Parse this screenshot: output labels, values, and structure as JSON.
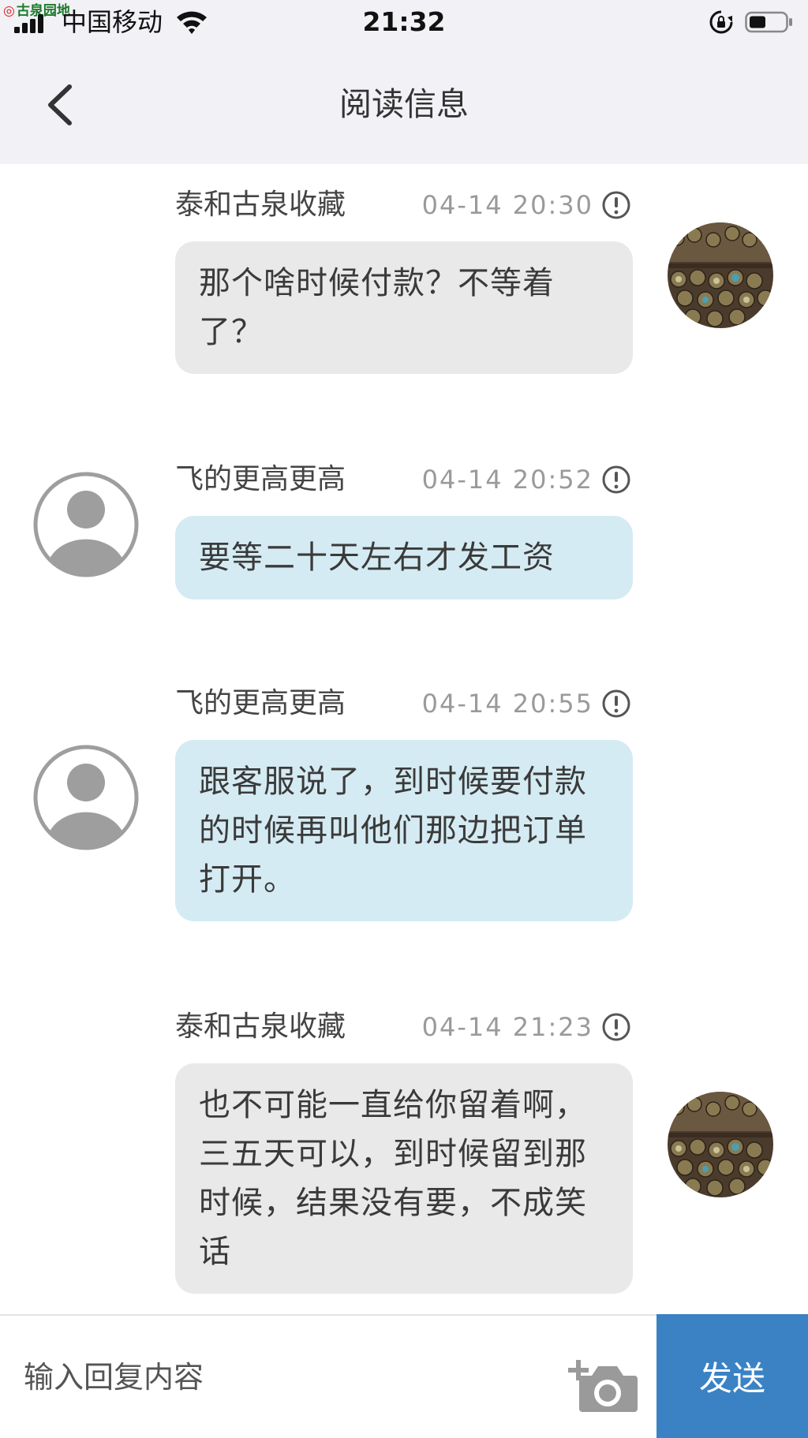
{
  "status_bar": {
    "watermark": "古泉园地",
    "carrier": "中国移动",
    "time": "21:32"
  },
  "nav": {
    "back_icon": "chevron-left-icon",
    "title": "阅读信息"
  },
  "messages": [
    {
      "side": "self",
      "sender": "泰和古泉收藏",
      "time": "04-14 20:30",
      "text": "那个啥时候付款？不等着了？"
    },
    {
      "side": "other",
      "sender": "飞的更高更高",
      "time": "04-14 20:52",
      "text": "要等二十天左右才发工资"
    },
    {
      "side": "other",
      "sender": "飞的更高更高",
      "time": "04-14 20:55",
      "text": "跟客服说了，到时候要付款的时候再叫他们那边把订单打开。"
    },
    {
      "side": "self",
      "sender": "泰和古泉收藏",
      "time": "04-14 21:23",
      "text": "也不可能一直给你留着啊，三五天可以，到时候留到那时候，结果没有要，不成笑话"
    }
  ],
  "input_bar": {
    "placeholder": "输入回复内容",
    "camera_icon": "camera-add-icon",
    "send_label": "发送"
  },
  "colors": {
    "self_bubble": "#e9e9e9",
    "other_bubble": "#d5ebf3",
    "send_button": "#3b82c4",
    "header_bg": "#f1f1f6"
  }
}
